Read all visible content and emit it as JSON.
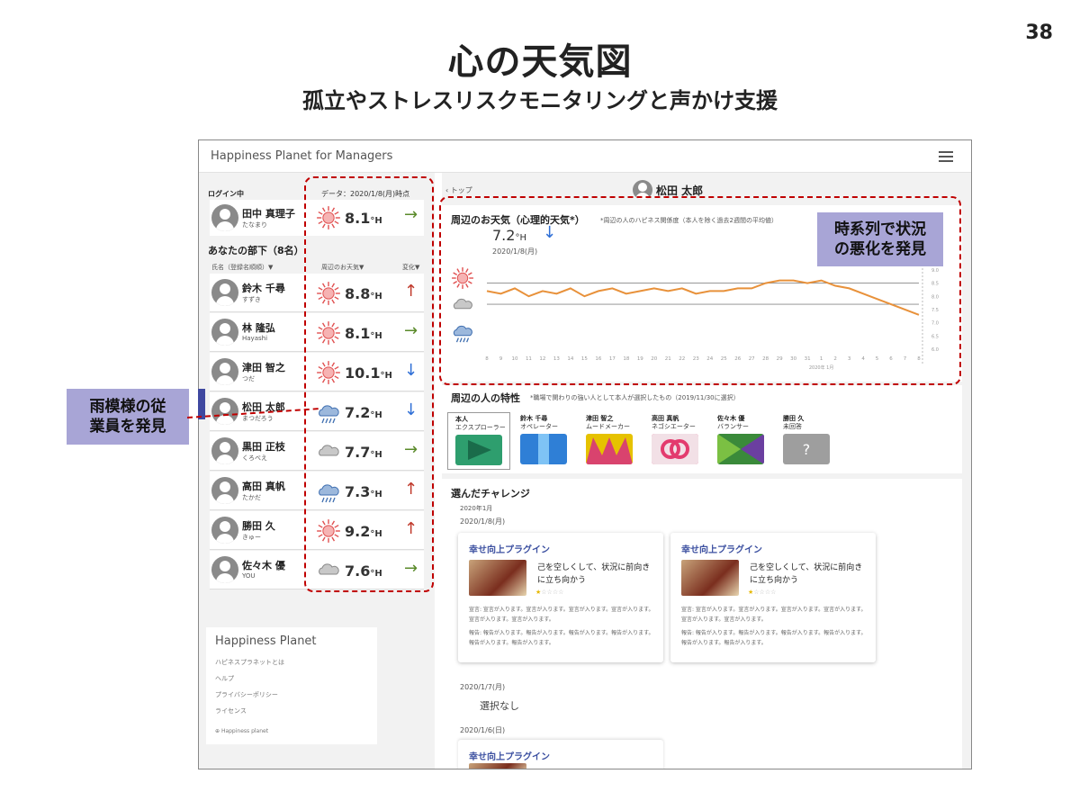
{
  "slide": {
    "number": "38",
    "title": "心の天気図",
    "subtitle": "孤立やストレスリスクモニタリングと声かけ支援"
  },
  "app": {
    "title": "Happiness Planet  for Managers",
    "menu_icon": "hamburger-menu-icon"
  },
  "login": {
    "label": "ログイン中",
    "data_date": "データ：2020/1/8(月)時点",
    "name": "田中 真理子",
    "kana": "たなまり",
    "weather": "sun",
    "value": "8.1",
    "unit": "°H",
    "trend": "→"
  },
  "team": {
    "title": "あなたの部下（8名）",
    "col_name": "氏名（登録名順順）▼",
    "col_weather": "周辺のお天気▼",
    "col_change": "変化▼",
    "members": [
      {
        "name": "鈴木 千尋",
        "kana": "すずき",
        "weather": "sun",
        "value": "8.8",
        "unit": "°H",
        "trend": "↑"
      },
      {
        "name": "林 隆弘",
        "kana": "Hayashi",
        "weather": "sun",
        "value": "8.1",
        "unit": "°H",
        "trend": "→"
      },
      {
        "name": "津田 智之",
        "kana": "つだ",
        "weather": "sun",
        "value": "10.1",
        "unit": "°H",
        "trend": "↓"
      },
      {
        "name": "松田 太郎",
        "kana": "まつだろう",
        "weather": "rain",
        "value": "7.2",
        "unit": "°H",
        "trend": "↓"
      },
      {
        "name": "黒田 正枝",
        "kana": "くろべえ",
        "weather": "cloud",
        "value": "7.7",
        "unit": "°H",
        "trend": "→"
      },
      {
        "name": "高田 真帆",
        "kana": "たかだ",
        "weather": "rain",
        "value": "7.3",
        "unit": "°H",
        "trend": "↑"
      },
      {
        "name": "勝田 久",
        "kana": "きゅー",
        "weather": "sun",
        "value": "9.2",
        "unit": "°H",
        "trend": "↑"
      },
      {
        "name": "佐々木 優",
        "kana": "YOU",
        "weather": "cloud",
        "value": "7.6",
        "unit": "°H",
        "trend": "→"
      }
    ]
  },
  "hp_box": {
    "title": "Happiness Planet",
    "links": [
      "ハピネスプラネットとは",
      "ヘルプ",
      "プライバシーポリシー",
      "ライセンス"
    ],
    "footer": "Happiness planet"
  },
  "detail": {
    "back": "トップ",
    "user_name": "松田 太郎",
    "weather_panel": {
      "title": "周辺のお天気（心理的天気*）",
      "note": "*周辺の人のハピネス関係度（本人を除く過去2週間の平均値）",
      "value": "7.2",
      "unit": "°H",
      "trend": "↓",
      "date": "2020/1/8(月)"
    },
    "traits_panel": {
      "title": "周辺の人の特性",
      "note": "*職場で関わりの強い人として本人が選択したもの（2019/11/30に選択）",
      "traits": [
        {
          "name": "本人",
          "type": "エクスプローラー",
          "color": "#2e9e6e",
          "mark": "play"
        },
        {
          "name": "鈴木 千尋",
          "type": "オペレーター",
          "color": "#2f7fd6",
          "mark": "bars"
        },
        {
          "name": "津田 智之",
          "type": "ムードメーカー",
          "color": "#e6c200",
          "mark": "zigzag"
        },
        {
          "name": "高田 真帆",
          "type": "ネゴシエーター",
          "color": "#e33b6e",
          "mark": "rings"
        },
        {
          "name": "佐々木 優",
          "type": "バランサー",
          "color": "#3a8a3a",
          "mark": "bowtie"
        },
        {
          "name": "勝田 久",
          "type": "未回答",
          "color": "#9e9e9e",
          "mark": "?"
        }
      ]
    },
    "challenge_panel": {
      "title": "選んだチャレンジ",
      "month": "2020年1月",
      "date1": "2020/1/8(月)",
      "cards": [
        {
          "title": "幸せ向上プラグイン",
          "text": "己を空しくして、状況に前向きに立ち向かう",
          "stars": "★☆☆☆☆",
          "body1": "宣言: 宣言が入ります。宣言が入ります。宣言が入ります。宣言が入ります。宣言が入ります。宣言が入ります。",
          "body2": "報告: 報告が入ります。報告が入ります。報告が入ります。報告が入ります。報告が入ります。報告が入ります。"
        },
        {
          "title": "幸せ向上プラグイン",
          "text": "己を空しくして、状況に前向きに立ち向かう",
          "stars": "★☆☆☆☆",
          "body1": "宣言: 宣言が入ります。宣言が入ります。宣言が入ります。宣言が入ります。宣言が入ります。宣言が入ります。",
          "body2": "報告: 報告が入ります。報告が入ります。報告が入ります。報告が入ります。報告が入ります。報告が入ります。"
        }
      ],
      "date2": "2020/1/7(月)",
      "none_selected": "選択なし",
      "date3": "2020/1/6(日)",
      "card3_title": "幸せ向上プラグイン"
    }
  },
  "annotations": {
    "left": [
      "雨模様の従",
      "業員を発見"
    ],
    "right": [
      "時系列で状況",
      "の悪化を発見"
    ]
  },
  "chart_data": {
    "type": "line",
    "x": [
      "8",
      "9",
      "10",
      "11",
      "12",
      "13",
      "14",
      "15",
      "16",
      "17",
      "18",
      "19",
      "20",
      "21",
      "22",
      "23",
      "24",
      "25",
      "26",
      "27",
      "28",
      "29",
      "30",
      "31",
      "1",
      "2",
      "3",
      "4",
      "5",
      "6",
      "7",
      "8"
    ],
    "x_sublabel": "2020年 1月",
    "y_ticks": [
      "9.0",
      "8.5",
      "8.0",
      "7.5",
      "7.0",
      "6.5",
      "6.0"
    ],
    "ylim": [
      6.0,
      9.2
    ],
    "legend_icons": [
      "sun",
      "cloud",
      "rain"
    ],
    "series": [
      {
        "values": [
          8.2,
          8.1,
          8.3,
          8.0,
          8.2,
          8.1,
          8.3,
          8.0,
          8.2,
          8.3,
          8.1,
          8.2,
          8.3,
          8.2,
          8.3,
          8.1,
          8.2,
          8.2,
          8.3,
          8.3,
          8.5,
          8.6,
          8.6,
          8.5,
          8.6,
          8.4,
          8.3,
          8.1,
          7.9,
          7.7,
          7.5,
          7.3
        ]
      }
    ],
    "line_color": "#e8913a"
  }
}
